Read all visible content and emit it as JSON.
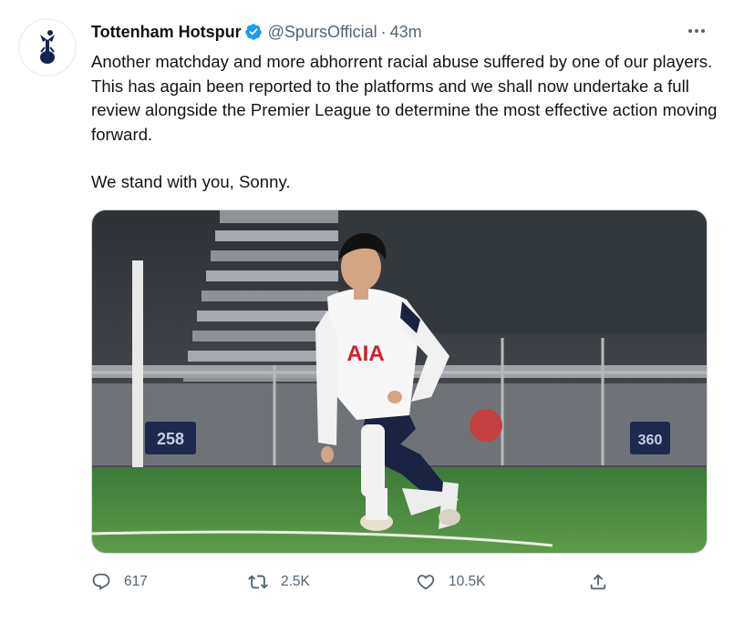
{
  "tweet": {
    "author_name": "Tottenham Hotspur",
    "handle": "@SpursOfficial",
    "separator": "·",
    "time": "43m",
    "more_icon": "more-horizontal-icon",
    "text_p1": "Another matchday and more abhorrent racial abuse suffered by one of our players. This has again been reported to the platforms and we shall now undertake a full review alongside the Premier League to determine the most effective action moving forward.",
    "text_p2": "We stand with you, Sonny.",
    "media": {
      "shirt_sponsor": "AIA",
      "stand_sign_left": "258",
      "stand_sign_right": "360"
    },
    "actions": {
      "reply_count": "617",
      "retweet_count": "2.5K",
      "like_count": "10.5K"
    }
  },
  "colors": {
    "text": "#0f1419",
    "secondary": "#536471",
    "verified_blue": "#1d9bf0",
    "club_navy": "#132257"
  }
}
